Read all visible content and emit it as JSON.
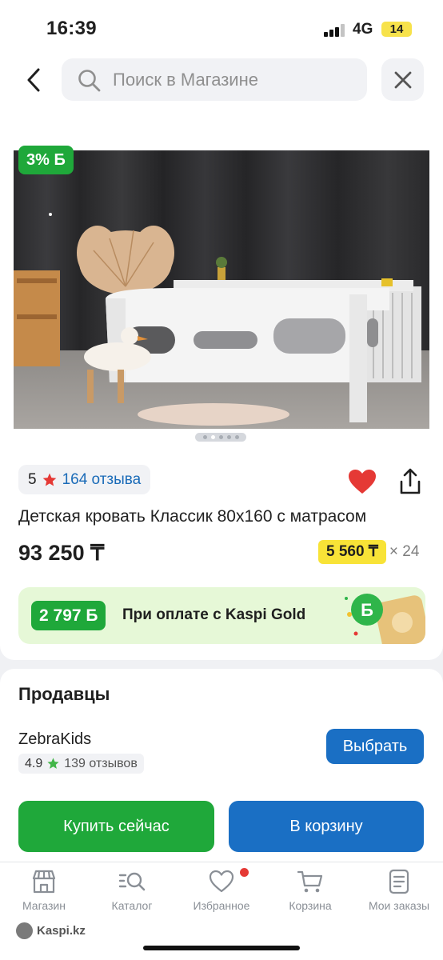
{
  "status_bar": {
    "time": "16:39",
    "network": "4G",
    "battery": "14"
  },
  "search": {
    "placeholder": "Поиск в Магазине"
  },
  "product": {
    "cashback_badge": "3% Б",
    "rating": "5",
    "reviews": "164 отзыва",
    "title": "Детская кровать Классик 80х160 с матрасом",
    "price": "93 250 ₸",
    "installment_amount": "5 560 ₸",
    "installment_months": "× 24",
    "image_page_count": 5,
    "image_page_active": 1
  },
  "gold_banner": {
    "bonus": "2 797 Б",
    "text": "При оплате с Kaspi Gold"
  },
  "sellers": {
    "title": "Продавцы",
    "items": [
      {
        "name": "ZebraKids",
        "score": "4.9",
        "reviews": "139 отзывов",
        "button": "Выбрать"
      }
    ]
  },
  "actions": {
    "buy_now": "Купить сейчас",
    "add_to_cart": "В корзину"
  },
  "tab_bar": [
    {
      "label": "Магазин",
      "icon": "store-icon"
    },
    {
      "label": "Каталог",
      "icon": "catalog-search-icon"
    },
    {
      "label": "Избранное",
      "icon": "heart-icon"
    },
    {
      "label": "Корзина",
      "icon": "cart-icon"
    },
    {
      "label": "Мои заказы",
      "icon": "orders-icon"
    }
  ],
  "branding": {
    "logo_text": "Kaspi.kz"
  },
  "colors": {
    "accent_blue": "#1a6fc4",
    "accent_green": "#1fa83a",
    "accent_yellow": "#f8e337",
    "heart_red": "#e53935",
    "link_blue": "#1a6bb8"
  }
}
